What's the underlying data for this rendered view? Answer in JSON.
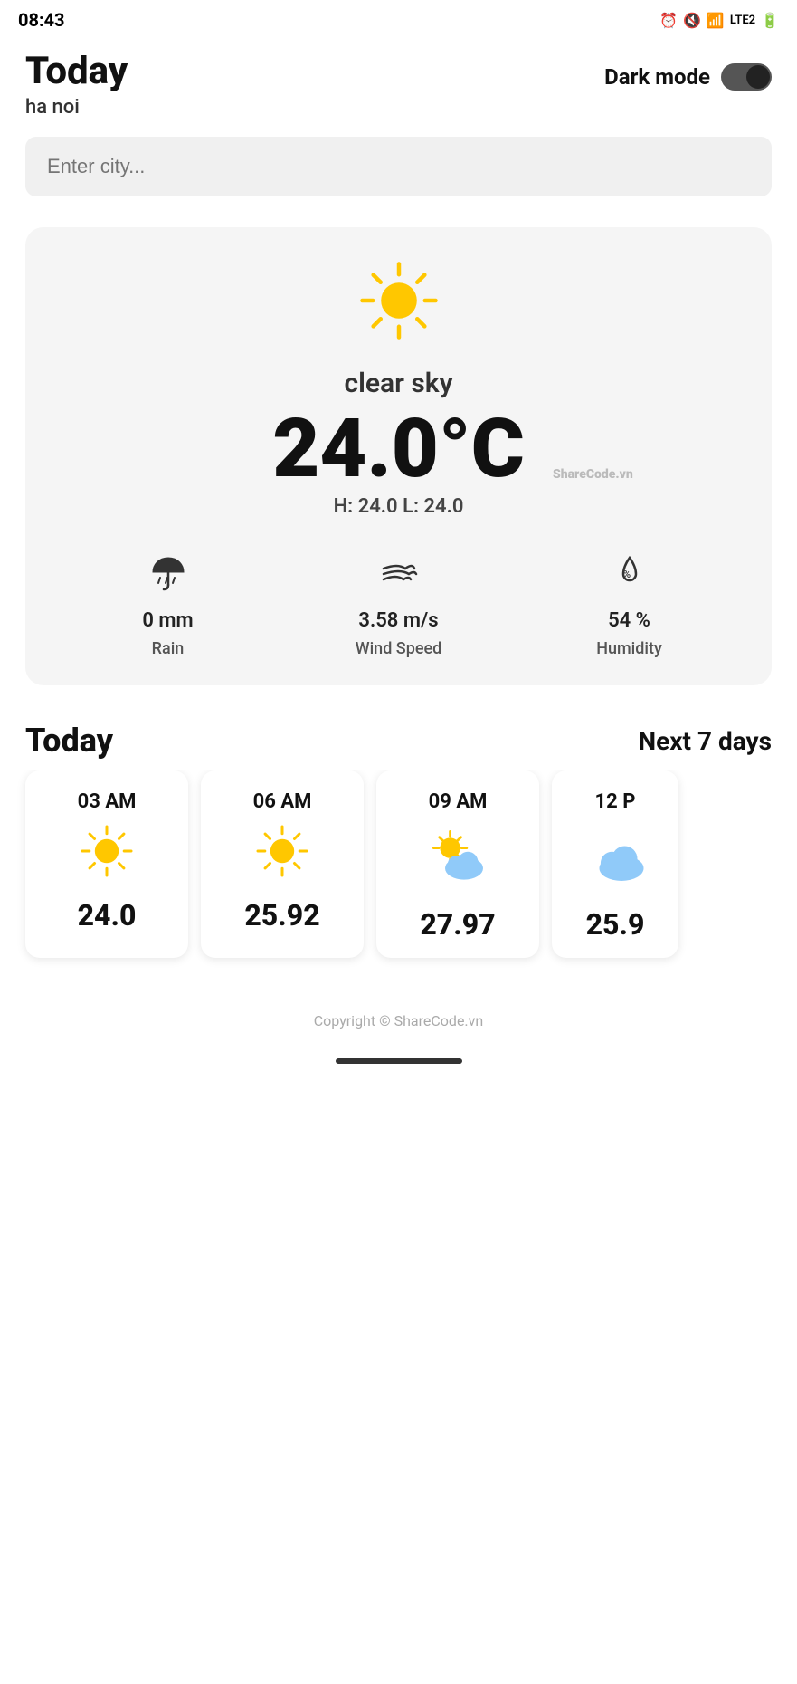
{
  "statusBar": {
    "time": "08:43"
  },
  "header": {
    "title": "Today",
    "city": "ha noi",
    "darkModeLabel": "Dark mode"
  },
  "search": {
    "placeholder": "Enter city..."
  },
  "weatherCard": {
    "description": "clear sky",
    "temperature": "24.0°C",
    "high": "24.0",
    "low": "24.0",
    "highLowLabel": "H: 24.0 L: 24.0",
    "rain": {
      "value": "0 mm",
      "label": "Rain"
    },
    "wind": {
      "value": "3.58 m/s",
      "label": "Wind Speed"
    },
    "humidity": {
      "value": "54 %",
      "label": "Humidity"
    }
  },
  "forecastHeader": {
    "todayLabel": "Today",
    "nextLabel": "Next 7 days"
  },
  "hourlyForecast": [
    {
      "time": "03 AM",
      "weather": "sun",
      "temp": "24.0"
    },
    {
      "time": "06 AM",
      "weather": "sun",
      "temp": "25.92"
    },
    {
      "time": "09 AM",
      "weather": "partly-cloudy",
      "temp": "27.97"
    },
    {
      "time": "12 P",
      "weather": "cloud",
      "temp": "25.9"
    }
  ],
  "copyright": "Copyright © ShareCode.vn",
  "watermark": "ShareCode.vn"
}
